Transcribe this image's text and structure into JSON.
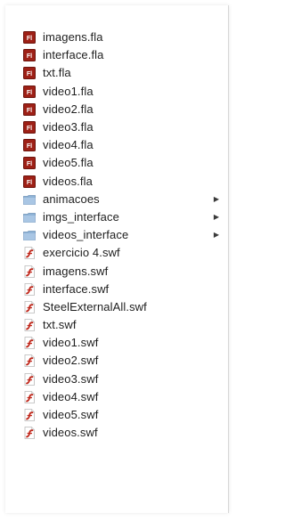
{
  "file_list": {
    "items": [
      {
        "name": "imagens.fla",
        "kind": "fla",
        "icon": "fla-file-icon"
      },
      {
        "name": "interface.fla",
        "kind": "fla",
        "icon": "fla-file-icon"
      },
      {
        "name": "txt.fla",
        "kind": "fla",
        "icon": "fla-file-icon"
      },
      {
        "name": "video1.fla",
        "kind": "fla",
        "icon": "fla-file-icon"
      },
      {
        "name": "video2.fla",
        "kind": "fla",
        "icon": "fla-file-icon"
      },
      {
        "name": "video3.fla",
        "kind": "fla",
        "icon": "fla-file-icon"
      },
      {
        "name": "video4.fla",
        "kind": "fla",
        "icon": "fla-file-icon"
      },
      {
        "name": "video5.fla",
        "kind": "fla",
        "icon": "fla-file-icon"
      },
      {
        "name": "videos.fla",
        "kind": "fla",
        "icon": "fla-file-icon"
      },
      {
        "name": "animacoes",
        "kind": "folder",
        "icon": "folder-icon",
        "has_children": true
      },
      {
        "name": "imgs_interface",
        "kind": "folder",
        "icon": "folder-icon",
        "has_children": true
      },
      {
        "name": "videos_interface",
        "kind": "folder",
        "icon": "folder-icon",
        "has_children": true
      },
      {
        "name": "exercicio 4.swf",
        "kind": "swf",
        "icon": "swf-file-icon"
      },
      {
        "name": "imagens.swf",
        "kind": "swf",
        "icon": "swf-file-icon"
      },
      {
        "name": "interface.swf",
        "kind": "swf",
        "icon": "swf-file-icon"
      },
      {
        "name": "SteelExternalAll.swf",
        "kind": "swf",
        "icon": "swf-file-icon"
      },
      {
        "name": "txt.swf",
        "kind": "swf",
        "icon": "swf-file-icon"
      },
      {
        "name": "video1.swf",
        "kind": "swf",
        "icon": "swf-file-icon"
      },
      {
        "name": "video2.swf",
        "kind": "swf",
        "icon": "swf-file-icon"
      },
      {
        "name": "video3.swf",
        "kind": "swf",
        "icon": "swf-file-icon"
      },
      {
        "name": "video4.swf",
        "kind": "swf",
        "icon": "swf-file-icon"
      },
      {
        "name": "video5.swf",
        "kind": "swf",
        "icon": "swf-file-icon"
      },
      {
        "name": "videos.swf",
        "kind": "swf",
        "icon": "swf-file-icon"
      }
    ]
  },
  "colors": {
    "fla_icon": "#9e2016",
    "folder_icon": "#8fb3d6",
    "swf_icon": "#c0281c",
    "text": "#1e1e1e"
  }
}
